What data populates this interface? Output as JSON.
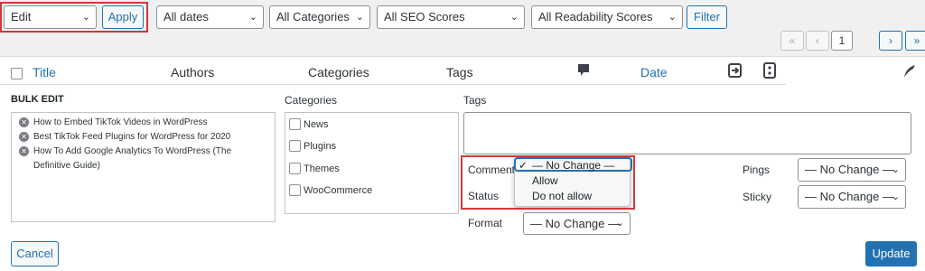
{
  "toolbar": {
    "bulk_action": "Edit",
    "apply_label": "Apply",
    "dates_filter": "All dates",
    "categories_filter": "All Categories",
    "seo_filter": "All SEO Scores",
    "readability_filter": "All Readability Scores",
    "filter_label": "Filter"
  },
  "pagination": {
    "first": "«",
    "prev": "‹",
    "current_page": "1",
    "next": "›",
    "last": "»"
  },
  "table": {
    "headers": {
      "title": "Title",
      "authors": "Authors",
      "categories": "Categories",
      "tags": "Tags",
      "date": "Date"
    }
  },
  "bulk_edit": {
    "heading": "BULK EDIT",
    "posts": [
      "How to Embed TikTok Videos in WordPress",
      "Best TikTok Feed Plugins for WordPress for 2020",
      "How To Add Google Analytics To WordPress (The Definitive Guide)"
    ],
    "categories_label": "Categories",
    "categories": [
      "News",
      "Plugins",
      "Themes",
      "WooCommerce"
    ],
    "tags_label": "Tags",
    "comments_label": "Comments",
    "status_label": "Status",
    "format_label": "Format",
    "format_value": "— No Change —",
    "pings_label": "Pings",
    "pings_value": "— No Change —",
    "sticky_label": "Sticky",
    "sticky_value": "— No Change —",
    "comments_dropdown": {
      "check": "✓",
      "options": [
        "— No Change —",
        "Allow",
        "Do not allow"
      ],
      "selected": "— No Change —"
    },
    "cancel_label": "Cancel",
    "update_label": "Update"
  },
  "colors": {
    "accent": "#2271b1",
    "highlight": "#d63638"
  }
}
